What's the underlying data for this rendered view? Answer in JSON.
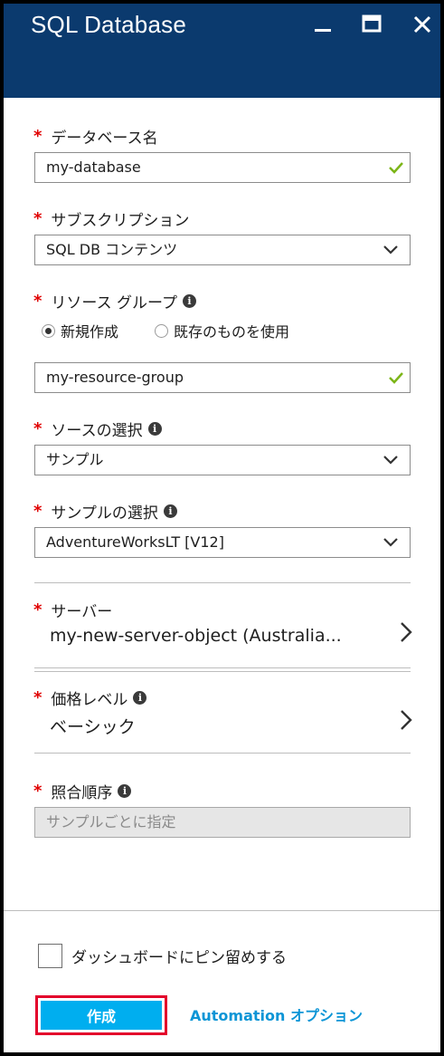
{
  "window": {
    "title": "SQL Database"
  },
  "form": {
    "db_name": {
      "label": "データベース名",
      "value": "my-database"
    },
    "subscription": {
      "label": "サブスクリプション",
      "value": "SQL DB コンテンツ"
    },
    "resource_group": {
      "label": "リソース グループ",
      "option_new": "新規作成",
      "option_existing": "既存のものを使用",
      "value": "my-resource-group"
    },
    "source": {
      "label": "ソースの選択",
      "value": "サンプル"
    },
    "sample": {
      "label": "サンプルの選択",
      "value": "AdventureWorksLT [V12]"
    },
    "server": {
      "label": "サーバー",
      "value": "my-new-server-object (Australia..."
    },
    "pricing": {
      "label": "価格レベル",
      "value": "ベーシック"
    },
    "collation": {
      "label": "照合順序",
      "value": "サンプルごとに指定"
    }
  },
  "footer": {
    "pin_label": "ダッシュボードにピン留めする",
    "create_label": "作成",
    "automation_label": "Automation オプション"
  },
  "colors": {
    "header_bg": "#0b3a6e",
    "required": "#e00000",
    "valid_check": "#7cb518",
    "create_button": "#00aeef",
    "highlight_border": "#e3002b",
    "link": "#0c95d6"
  },
  "icons": {
    "minimize": "minimize-icon",
    "maximize": "maximize-icon",
    "close": "close-icon",
    "check": "checkmark-icon",
    "dropdown": "chevron-down-icon",
    "navigate": "chevron-right-icon",
    "info": "info-icon"
  }
}
